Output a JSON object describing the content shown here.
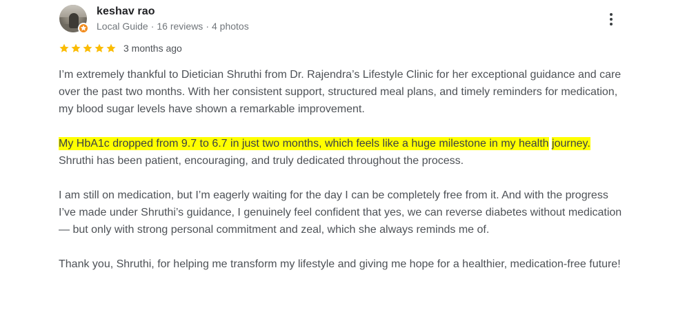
{
  "author": {
    "name": "keshav rao",
    "role": "Local Guide",
    "reviews": "16 reviews",
    "photos": "4 photos",
    "separator": "·"
  },
  "rating": {
    "stars": 5,
    "max_stars": 5,
    "date": "3 months ago"
  },
  "review": {
    "p1": "I’m extremely thankful to Dietician Shruthi from Dr. Rajendra’s Lifestyle Clinic for her exceptional guidance and care over the past two months. With her consistent support, structured meal plans, and timely reminders for medication, my blood sugar levels have shown a remarkable improvement.",
    "p2_highlight_line1": "My HbA1c dropped from 9.7 to 6.7 in just two months, which feels like a huge milestone in my health",
    "p2_highlight_line2": "journey.",
    "p2_rest": " Shruthi has been patient, encouraging, and truly dedicated throughout the process.",
    "p3": "I am still on medication, but I’m eagerly waiting for the day I can be completely free from it. And with the progress I’ve made under Shruthi’s guidance, I genuinely feel confident that yes, we can reverse diabetes without medication — but only with strong personal commitment and zeal, which she always reminds me of.",
    "p4": "Thank you, Shruthi, for helping me transform my lifestyle and giving me hope for a healthier, medication-free future!"
  },
  "colors": {
    "star": "#fbbc04",
    "highlight": "#ffff00",
    "guide_badge": "#f28b1c"
  },
  "icons": {
    "star": "star-icon",
    "more": "more-vert-icon",
    "badge": "local-guide-badge-icon"
  }
}
